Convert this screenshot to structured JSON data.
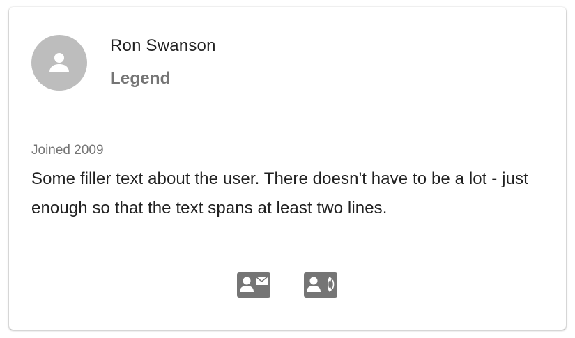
{
  "profile": {
    "name": "Ron Swanson",
    "title": "Legend",
    "joined": "Joined 2009",
    "bio": "Some filler text about the user. There doesn't have to be a lot - just enough so that the text spans at least two lines.",
    "avatar_icon": "person-icon"
  },
  "actions": {
    "email_icon": "contact-mail-icon",
    "phone_icon": "contact-phone-icon"
  },
  "colors": {
    "avatar_bg": "#bdbdbd",
    "icon": "#757575",
    "primary_text": "#212121",
    "secondary_text": "#757575"
  }
}
